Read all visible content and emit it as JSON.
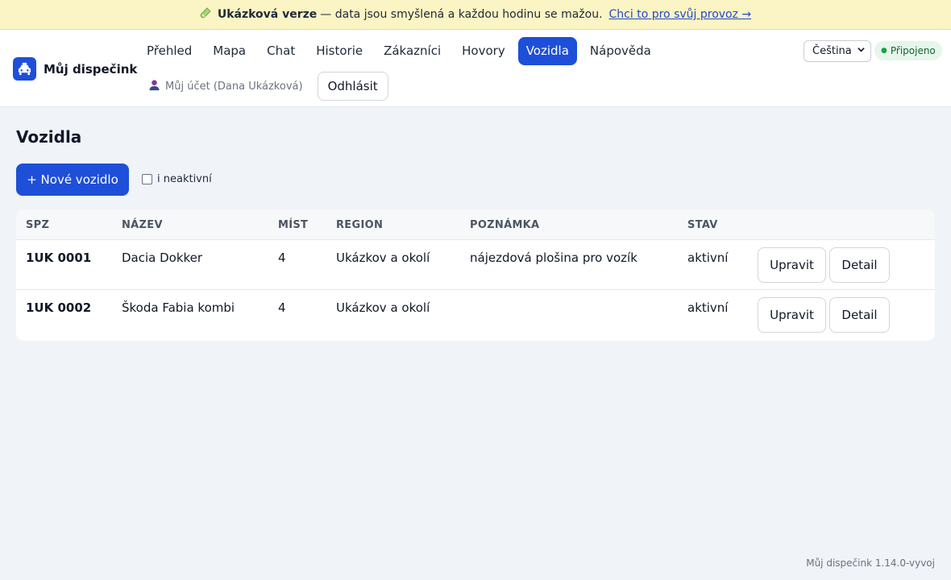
{
  "banner": {
    "strong": "Ukázková verze",
    "text": "— data jsou smyšlená a každou hodinu se mažou.",
    "link": "Chci to pro svůj provoz →"
  },
  "brand": {
    "name": "Můj dispečink"
  },
  "nav": {
    "items": [
      {
        "label": "Přehled"
      },
      {
        "label": "Mapa"
      },
      {
        "label": "Chat"
      },
      {
        "label": "Historie"
      },
      {
        "label": "Zákazníci"
      },
      {
        "label": "Hovory"
      },
      {
        "label": "Vozidla",
        "active": true
      },
      {
        "label": "Nápověda"
      }
    ]
  },
  "account": {
    "label": "Můj účet (Dana Ukázková)",
    "logout": "Odhlásit"
  },
  "language": {
    "selected": "Čeština"
  },
  "connection": {
    "status": "Připojeno"
  },
  "page": {
    "title": "Vozidla",
    "new_button": "+ Nové vozidlo",
    "inactive_toggle": "i neaktivní"
  },
  "table": {
    "headers": {
      "spz": "SPZ",
      "name": "NÁZEV",
      "seats": "MÍST",
      "region": "REGION",
      "note": "POZNÁMKA",
      "state": "STAV"
    },
    "rows": [
      {
        "spz": "1UK 0001",
        "name": "Dacia Dokker",
        "seats": "4",
        "region": "Ukázkov a okolí",
        "note": "nájezdová plošina pro vozík",
        "state": "aktivní",
        "edit": "Upravit",
        "detail": "Detail"
      },
      {
        "spz": "1UK 0002",
        "name": "Škoda Fabia kombi",
        "seats": "4",
        "region": "Ukázkov a okolí",
        "note": "",
        "state": "aktivní",
        "edit": "Upravit",
        "detail": "Detail"
      }
    ]
  },
  "footer": {
    "version": "Můj dispečink 1.14.0-vyvoj"
  },
  "colors": {
    "accent": "#1e4fd8",
    "banner_bg": "#fbf4c4",
    "page_bg": "#f0f3f8",
    "connected_bg": "#e6f6ea",
    "connected_text": "#166534"
  }
}
